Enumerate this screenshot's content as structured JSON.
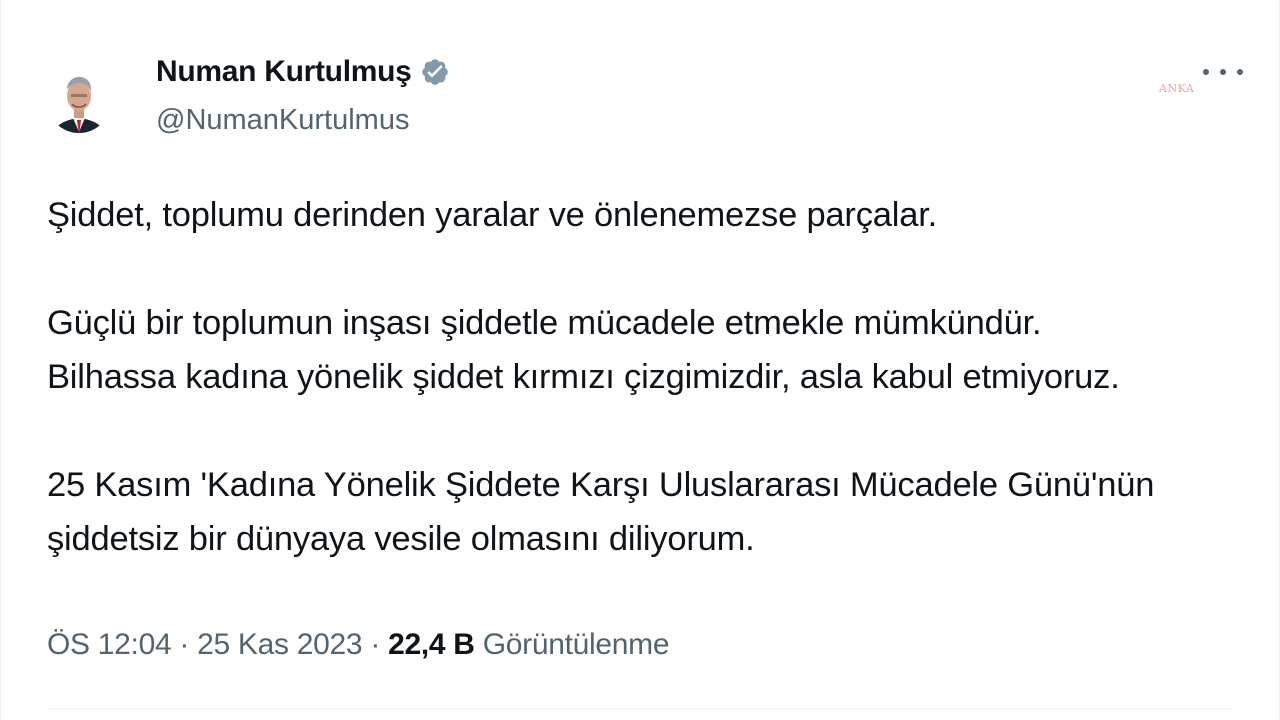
{
  "author": {
    "display_name": "Numan Kurtulmuş",
    "handle": "@NumanKurtulmus",
    "verified": true,
    "avatar_icon": "profile-photo"
  },
  "header": {
    "more_icon": "ellipsis-horizontal-icon",
    "watermark": "ANKA"
  },
  "tweet": {
    "paragraphs": [
      [
        "Şiddet, toplumu derinden yaralar ve önlenemezse parçalar."
      ],
      [
        "Güçlü bir toplumun inşası şiddetle mücadele etmekle mümkündür.",
        "Bilhassa kadına yönelik şiddet kırmızı çizgimizdir, asla kabul etmiyoruz."
      ],
      [
        "25 Kasım 'Kadına Yönelik Şiddete Karşı Uluslararası Mücadele Günü'nün",
        "şiddetsiz bir dünyaya vesile olmasını diliyorum."
      ]
    ]
  },
  "meta": {
    "time": "ÖS 12:04",
    "separator": " · ",
    "date": "25 Kas 2023",
    "views_count": "22,4 B",
    "views_label": "Görüntülenme"
  },
  "colors": {
    "text_primary": "#0f1419",
    "text_secondary": "#536471",
    "verified_badge": "#829aab",
    "divider": "#eff3f4"
  }
}
